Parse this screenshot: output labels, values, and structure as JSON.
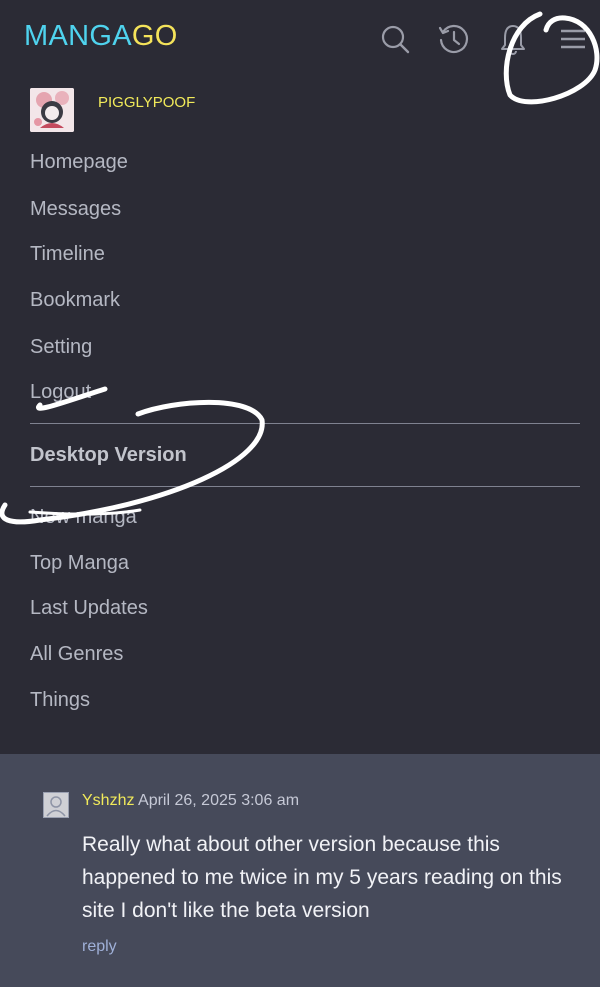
{
  "header": {
    "logo_part1": "MANGA",
    "logo_part2": "GO",
    "colors": {
      "logo_part1": "#4fd3ee",
      "logo_part2": "#f4e35a"
    },
    "icons": [
      "search-icon",
      "history-icon",
      "bell-icon",
      "menu-icon"
    ]
  },
  "user": {
    "name": "PIGGLYPOOF"
  },
  "menu": {
    "account_items": [
      "Homepage",
      "Messages",
      "Timeline",
      "Bookmark",
      "Setting",
      "Logout"
    ],
    "desktop_version": "Desktop Version",
    "browse_items": [
      "New manga",
      "Top Manga",
      "Last Updates",
      "All Genres",
      "Things"
    ]
  },
  "comment": {
    "user": "Yshzhz",
    "date": "April 26, 2025 3:06 am",
    "text": "Really what about other version because this happened to me twice in my 5 years reading on this site I don't like the beta version",
    "reply_label": "reply"
  }
}
